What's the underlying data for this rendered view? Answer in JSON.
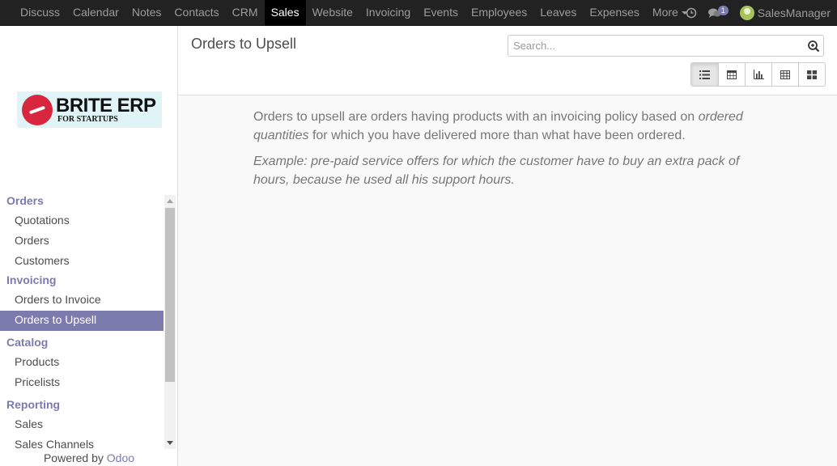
{
  "topbar": {
    "menu": [
      "Discuss",
      "Calendar",
      "Notes",
      "Contacts",
      "CRM",
      "Sales",
      "Website",
      "Invoicing",
      "Events",
      "Employees",
      "Leaves",
      "Expenses",
      "More"
    ],
    "active_index": 5,
    "icons": {
      "clock": "clock-icon",
      "chat": "chat-bubbles-icon",
      "user": "user-avatar"
    },
    "message_count": "1",
    "user_name": "SalesManager"
  },
  "sidebar": {
    "logo": {
      "title": "BRITE ERP",
      "subtitle": "FOR STARTUPS"
    },
    "sections": [
      {
        "label": "Orders",
        "items": [
          "Quotations",
          "Orders",
          "Customers"
        ]
      },
      {
        "label": "Invoicing",
        "items": [
          "Orders to Invoice",
          "Orders to Upsell"
        ]
      },
      {
        "label": "Catalog",
        "items": [
          "Products",
          "Pricelists"
        ]
      },
      {
        "label": "Reporting",
        "items": [
          "Sales",
          "Sales Channels"
        ]
      }
    ],
    "active_item": "Orders to Upsell",
    "powered_by": "Powered by",
    "powered_brand": "Odoo"
  },
  "control_panel": {
    "title": "Orders to Upsell",
    "search_placeholder": "Search...",
    "views": [
      "list-view-icon",
      "calendar-view-icon",
      "graph-view-icon",
      "pivot-view-icon",
      "kanban-view-icon"
    ],
    "active_view": "list-view-icon"
  },
  "helper": {
    "line1_start": "Orders to upsell are orders having products with an invoicing policy based on ",
    "line1_em": "ordered quantities",
    "line1_end": " for which you have delivered more than what have been ordered.",
    "example": "Example: pre-paid service offers for which the customer have to buy an extra pack of hours, because he used all his support hours."
  },
  "colors": {
    "accent": "#7c7bad",
    "navbar": "#222222",
    "active_menu": "#000000"
  }
}
